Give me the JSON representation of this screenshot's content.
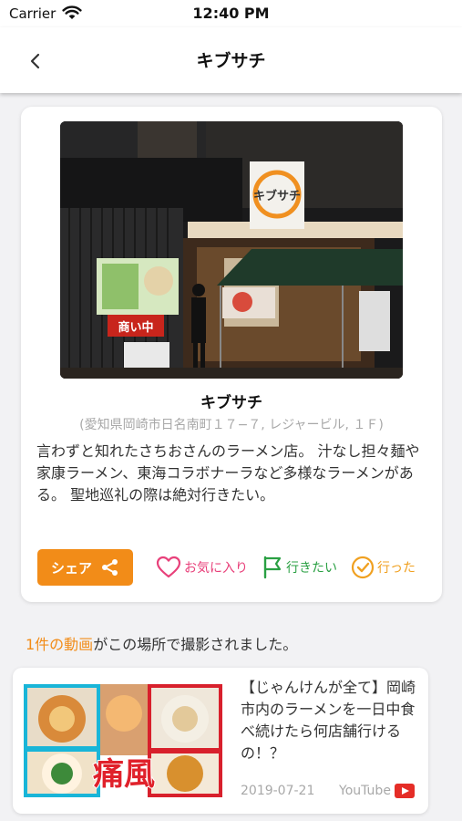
{
  "status_bar": {
    "carrier": "Carrier",
    "time": "12:40 PM"
  },
  "nav": {
    "title": "キブサチ"
  },
  "place": {
    "name": "キブサチ",
    "address": "(愛知県岡崎市日名南町１７−７, レジャービル, １Ｆ)",
    "description": "言わずと知れたさちおさんのラーメン店。 汁なし担々麺や家康ラーメン、東海コラボナーラなど多様なラーメンがある。 聖地巡礼の際は絶対行きたい。",
    "photo_sign_text": "キブサチ",
    "photo_banner_text": "商い中"
  },
  "actions": {
    "share": "シェア",
    "favorite": "お気に入り",
    "want_to_go": "行きたい",
    "been": "行った"
  },
  "videos": {
    "count_link": "1件の動画",
    "count_suffix": "がこの場所で撮影されました。",
    "items": [
      {
        "title": "【じゃんけんが全て】岡崎市内のラーメンを一日中食べ続けたら何店舗行けるの！？",
        "date": "2019-07-21",
        "source": "YouTube",
        "thumb_caption": "痛風"
      }
    ]
  },
  "colors": {
    "accent": "#f28c18",
    "favorite": "#e8407a",
    "want_to_go": "#2aa043",
    "been": "#f0a020"
  },
  "icons": {
    "back": "chevron-left-icon",
    "share": "share-icon",
    "favorite": "heart-icon",
    "want_to_go": "flag-icon",
    "been": "check-circle-icon",
    "youtube": "youtube-icon",
    "wifi": "wifi-icon"
  }
}
